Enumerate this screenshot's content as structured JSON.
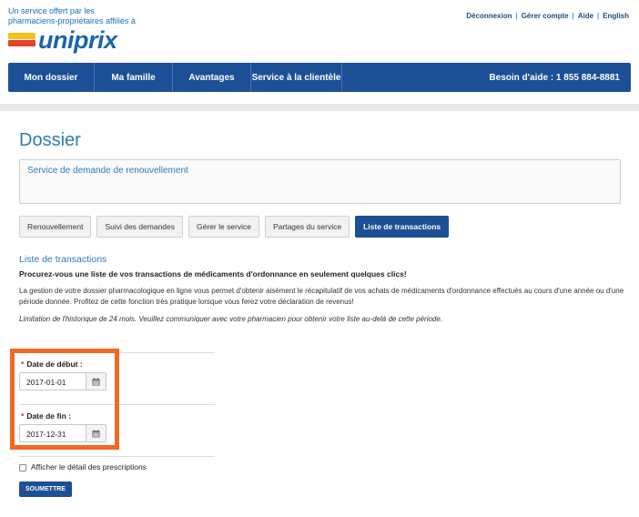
{
  "header": {
    "tagline": "Un service offert par les pharmaciens-propriétaires affiliés à",
    "logo_text": "uniprix",
    "links": [
      "Déconnexion",
      "Gérer compte",
      "Aide",
      "English"
    ]
  },
  "nav": {
    "items": [
      "Mon dossier",
      "Ma famille",
      "Avantages",
      "Service à la clientèle"
    ],
    "help": "Besoin d'aide : 1 855 884-8881"
  },
  "page": {
    "title": "Dossier",
    "panel_text": "Service de demande de renouvellement"
  },
  "tabs": [
    {
      "label": "Renouvellement",
      "active": false
    },
    {
      "label": "Suivi des demandes",
      "active": false
    },
    {
      "label": "Gérer le service",
      "active": false
    },
    {
      "label": "Partages du service",
      "active": false
    },
    {
      "label": "Liste de transactions",
      "active": true
    }
  ],
  "section": {
    "title": "Liste de transactions",
    "lead": "Procurez-vous une liste de vos transactions de médicaments d'ordonnance en seulement quelques clics!",
    "paragraph": "La gestion de votre dossier pharmacologique en ligne vous permet d'obtenir aisément le récapitulatif de vos achats de médicaments d'ordonnance effectués au cours d'une année ou d'une période donnée. Profitez de cette fonction très pratique lorsque vous ferez votre déclaration de revenus!",
    "note": "Limitation de l'historique de 24 mois. Veuillez communiquer avec votre pharmacien pour obtenir votre liste au-delà de cette période."
  },
  "form": {
    "start_label": "Date de début :",
    "start_value": "2017-01-01",
    "end_label": "Date de fin :",
    "end_value": "2017-12-31",
    "required_mark": "*",
    "checkbox_label": "Afficher le détail des prescriptions",
    "submit_label": "SOUMETTRE"
  },
  "colors": {
    "brand_blue": "#1c4f95",
    "accent_blue": "#2f7ab8",
    "highlight_orange": "#ef6a22",
    "logo_yellow": "#f3c21b",
    "logo_red": "#e8412a"
  }
}
